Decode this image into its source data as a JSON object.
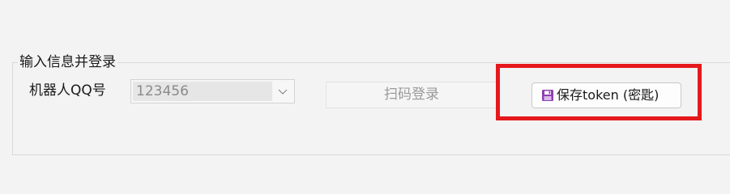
{
  "login_group": {
    "title": "输入信息并登录",
    "bot_qq_label": "机器人QQ号",
    "bot_qq_value": "123456",
    "scan_login_label": "扫码登录",
    "save_token_label": "保存token (密匙)"
  },
  "icons": {
    "dropdown": "chevron-down-icon",
    "save": "floppy-disk-icon"
  },
  "colors": {
    "highlight": "#e5191b",
    "save_icon": "#8e3fb0"
  }
}
